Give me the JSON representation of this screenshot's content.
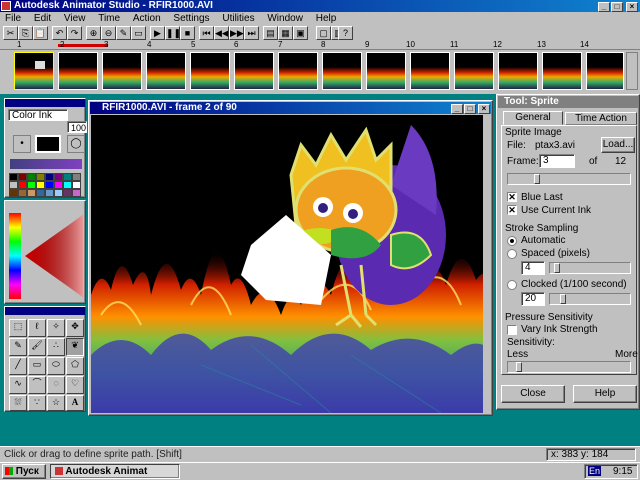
{
  "app": {
    "title": "Autodesk Animator Studio - RFIR1000.AVI"
  },
  "menu": [
    "File",
    "Edit",
    "View",
    "Time",
    "Action",
    "Settings",
    "Utilities",
    "Window",
    "Help"
  ],
  "timeline": {
    "ticks": [
      "1",
      "2",
      "3",
      "4",
      "5",
      "6",
      "7",
      "8",
      "9",
      "10",
      "11",
      "12",
      "13",
      "14"
    ]
  },
  "left_panel": {
    "ink": "Color Ink",
    "size": "100"
  },
  "palette": [
    "#000000",
    "#800000",
    "#008000",
    "#808000",
    "#000080",
    "#800080",
    "#008080",
    "#808080",
    "#c0c0c0",
    "#ff0000",
    "#00ff00",
    "#ffff00",
    "#0000ff",
    "#ff00ff",
    "#00ffff",
    "#ffffff",
    "#663300",
    "#996633",
    "#cc9966",
    "#336699",
    "#6699cc",
    "#99ccff",
    "#663366",
    "#cc66cc"
  ],
  "canvas": {
    "title": "RFIR1000.AVI - frame 2 of 90"
  },
  "sprite": {
    "title": "Tool: Sprite",
    "tabs": [
      "General",
      "Time Action"
    ],
    "image_label": "Sprite Image",
    "file_label": "File:",
    "file": "ptax3.avi",
    "load": "Load...",
    "frame_label": "Frame:",
    "frame": "3",
    "of": "of",
    "total": "12",
    "blue_last": "Blue Last",
    "use_current_ink": "Use Current Ink",
    "stroke_label": "Stroke Sampling",
    "automatic": "Automatic",
    "spaced": "Spaced (pixels)",
    "spaced_val": "4",
    "clocked": "Clocked (1/100 second)",
    "clocked_val": "20",
    "pressure_label": "Pressure Sensitivity",
    "vary": "Vary Ink Strength",
    "sensitivity": "Sensitivity:",
    "less": "Less",
    "more": "More",
    "close": "Close",
    "help": "Help"
  },
  "status": {
    "hint": "Click or drag to define sprite path. [Shift]",
    "coords": "x: 383  y: 184"
  },
  "taskbar": {
    "start": "Пуск",
    "task": "Autodesk Animat",
    "clock": "9:15",
    "lang": "En"
  }
}
